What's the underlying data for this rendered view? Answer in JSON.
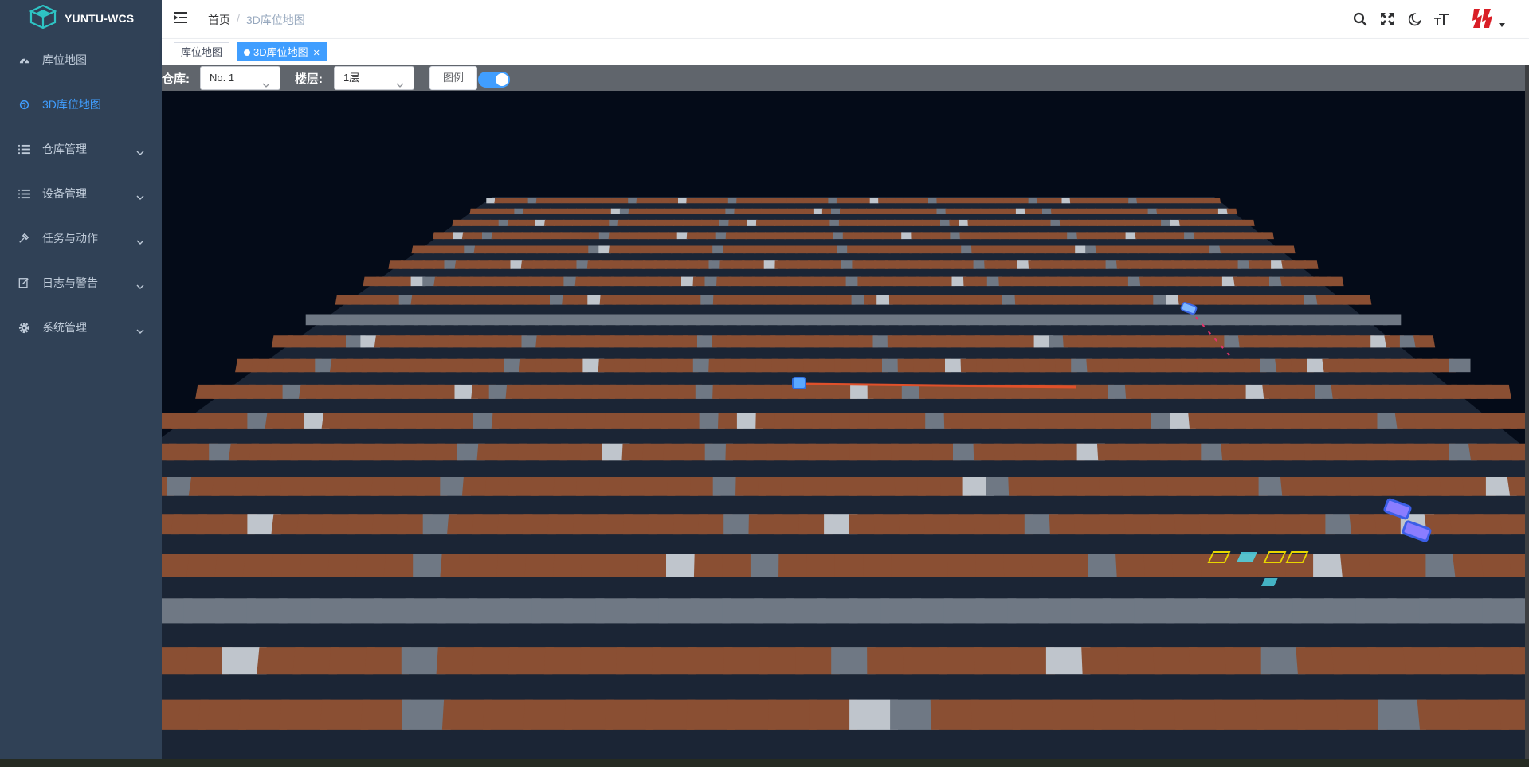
{
  "app": {
    "title": "YUNTU-WCS"
  },
  "colors": {
    "sidebar_bg": "#304156",
    "accent": "#409eff",
    "scene_bg": "#040b18"
  },
  "sidebar": {
    "items": [
      {
        "label": "库位地图",
        "icon": "dashboard-icon",
        "active": false,
        "expandable": false
      },
      {
        "label": "3D库位地图",
        "icon": "globe-icon",
        "active": true,
        "expandable": false
      },
      {
        "label": "仓库管理",
        "icon": "list-icon",
        "active": false,
        "expandable": true
      },
      {
        "label": "设备管理",
        "icon": "list-icon",
        "active": false,
        "expandable": true
      },
      {
        "label": "任务与动作",
        "icon": "tool-icon",
        "active": false,
        "expandable": true
      },
      {
        "label": "日志与警告",
        "icon": "edit-icon",
        "active": false,
        "expandable": true
      },
      {
        "label": "系统管理",
        "icon": "gear-icon",
        "active": false,
        "expandable": true
      }
    ]
  },
  "navbar": {
    "breadcrumb": [
      "首页",
      "3D库位地图"
    ],
    "icons": [
      "search-icon",
      "fullscreen-icon",
      "dark-mode-icon",
      "font-size-icon"
    ],
    "avatar": "brand-logo-avatar"
  },
  "tags": [
    {
      "label": "库位地图",
      "active": false
    },
    {
      "label": "3D库位地图",
      "active": true
    }
  ],
  "toolbar": {
    "warehouse_label": "仓库:",
    "warehouse_value": "No. 1",
    "floor_label": "楼层:",
    "floor_value": "1层",
    "legend_label": "图例",
    "legend_on": true
  }
}
